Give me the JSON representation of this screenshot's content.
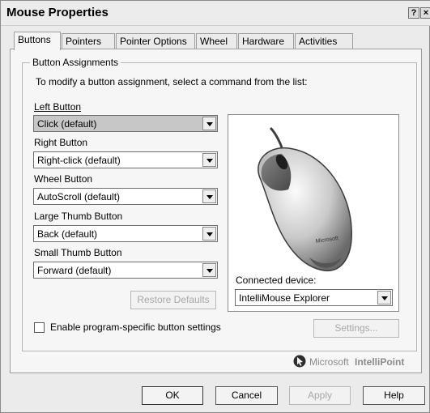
{
  "window": {
    "title": "Mouse Properties",
    "help_button": "?",
    "close_button": "×"
  },
  "tabs": [
    {
      "label": "Buttons"
    },
    {
      "label": "Pointers"
    },
    {
      "label": "Pointer Options"
    },
    {
      "label": "Wheel"
    },
    {
      "label": "Hardware"
    },
    {
      "label": "Activities"
    }
  ],
  "active_tab": "Buttons",
  "group": {
    "title": "Button Assignments",
    "instruction": "To modify a button assignment, select a command from the list:"
  },
  "buttons": [
    {
      "label": "Left Button",
      "value": "Click (default)"
    },
    {
      "label": "Right Button",
      "value": "Right-click (default)"
    },
    {
      "label": "Wheel Button",
      "value": "AutoScroll (default)"
    },
    {
      "label": "Large Thumb Button",
      "value": "Back (default)"
    },
    {
      "label": "Small Thumb Button",
      "value": "Forward (default)"
    }
  ],
  "restore_defaults": "Restore Defaults",
  "device": {
    "label": "Connected device:",
    "value": "IntelliMouse Explorer",
    "mouse_logo": "Microsoft"
  },
  "checkbox": {
    "label": "Enable program-specific button settings",
    "checked": false
  },
  "settings_button": "Settings...",
  "brand": {
    "prefix": "Microsoft",
    "name": "IntelliPoint"
  },
  "footer": {
    "ok": "OK",
    "cancel": "Cancel",
    "apply": "Apply",
    "help": "Help"
  },
  "colors": {
    "window_bg": "#ebebeb",
    "panel_bg": "#f6f6f6",
    "selected_field": "#c7c7c7",
    "disabled_text": "#a8a8a8"
  }
}
